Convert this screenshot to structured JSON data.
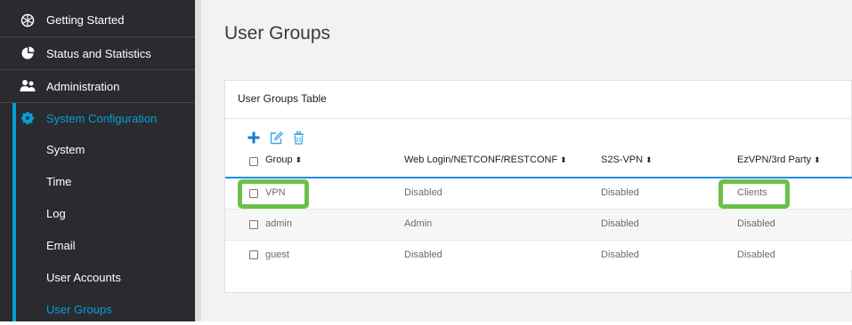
{
  "sidebar": {
    "items": [
      {
        "label": "Getting Started",
        "icon": "globe-icon"
      },
      {
        "label": "Status and Statistics",
        "icon": "pie-chart-icon"
      },
      {
        "label": "Administration",
        "icon": "users-icon"
      },
      {
        "label": "System Configuration",
        "icon": "gear-icon",
        "active": true
      }
    ],
    "sub_items": [
      {
        "label": "System"
      },
      {
        "label": "Time"
      },
      {
        "label": "Log"
      },
      {
        "label": "Email"
      },
      {
        "label": "User Accounts"
      },
      {
        "label": "User Groups",
        "active": true
      }
    ]
  },
  "page": {
    "title": "User Groups"
  },
  "table": {
    "title": "User Groups Table",
    "toolbar": {
      "add": "plus-icon",
      "edit": "edit-icon",
      "delete": "trash-icon"
    },
    "columns": [
      "Group",
      "Web Login/NETCONF/RESTCONF",
      "S2S-VPN",
      "EzVPN/3rd Party"
    ],
    "sort_glyph": "⬍",
    "rows": [
      {
        "group": "VPN",
        "web": "Disabled",
        "s2s": "Disabled",
        "ezvpn": "Clients"
      },
      {
        "group": "admin",
        "web": "Admin",
        "s2s": "Disabled",
        "ezvpn": "Disabled"
      },
      {
        "group": "guest",
        "web": "Disabled",
        "s2s": "Disabled",
        "ezvpn": "Disabled"
      }
    ]
  },
  "colors": {
    "sidebar_bg": "#2a2b2f",
    "accent": "#049fd9",
    "highlight": "#6cc04a",
    "table_header_line": "#1f8fe6"
  }
}
